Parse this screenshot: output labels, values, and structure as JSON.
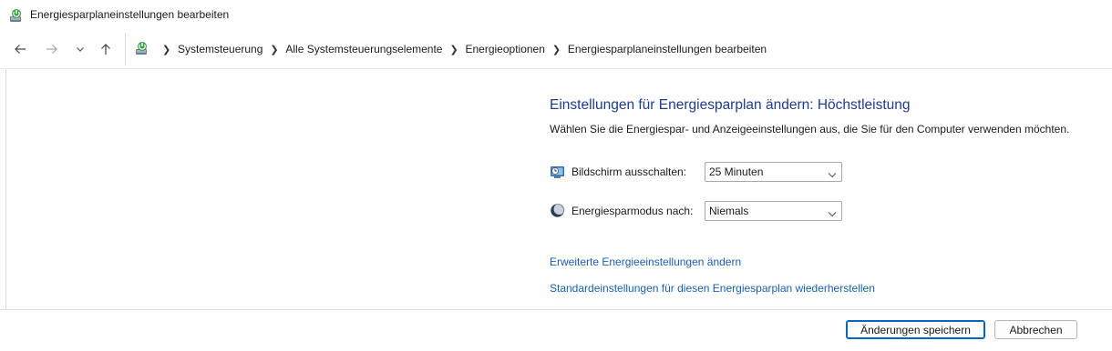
{
  "window": {
    "title": "Energiesparplaneinstellungen bearbeiten",
    "icon": "power-options-icon"
  },
  "nav": {
    "back_icon": "arrow-left-icon",
    "forward_icon": "arrow-right-icon",
    "recent_icon": "chevron-down-icon",
    "up_icon": "arrow-up-icon"
  },
  "breadcrumb": {
    "icon": "control-panel-icon",
    "items": [
      "Systemsteuerung",
      "Alle Systemsteuerungselemente",
      "Energieoptionen",
      "Energiesparplaneinstellungen bearbeiten"
    ]
  },
  "main": {
    "heading": "Einstellungen für Energiesparplan ändern: Höchstleistung",
    "subtitle": "Wählen Sie die Energiespar- und Anzeigeeinstellungen aus, die Sie für den Computer verwenden möchten.",
    "settings": [
      {
        "label": "Bildschirm ausschalten:",
        "value": "25 Minuten",
        "icon": "display-timer-icon"
      },
      {
        "label": "Energiesparmodus nach:",
        "value": "Niemals",
        "icon": "sleep-moon-icon"
      }
    ],
    "links": [
      "Erweiterte Energieeinstellungen ändern",
      "Standardeinstellungen für diesen Energiesparplan wiederherstellen"
    ]
  },
  "footer": {
    "save_label": "Änderungen speichern",
    "cancel_label": "Abbrechen"
  },
  "colors": {
    "heading": "#1e3c8c",
    "link": "#1a5fb4",
    "primary_border": "#0067c0"
  }
}
